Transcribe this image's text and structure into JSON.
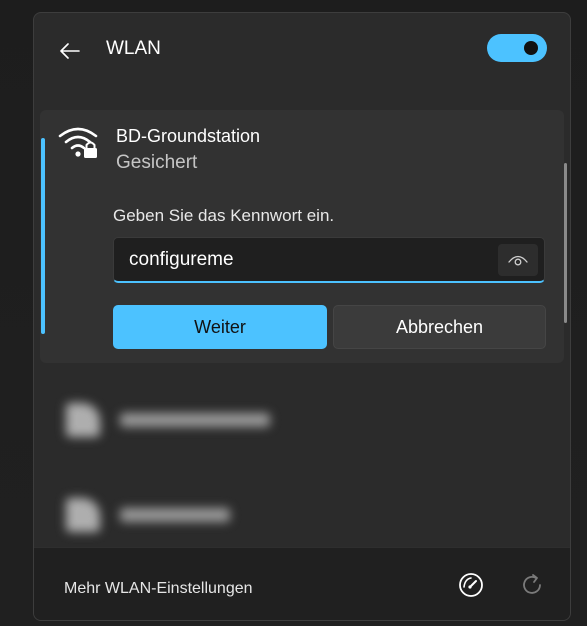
{
  "panel": {
    "title": "WLAN",
    "wifi_enabled": true
  },
  "network": {
    "name": "BD-Groundstation",
    "status": "Gesichert",
    "password_prompt": "Geben Sie das Kennwort ein.",
    "password_value": "configureme",
    "confirm_label": "Weiter",
    "cancel_label": "Abbrechen"
  },
  "footer": {
    "settings_link": "Mehr WLAN-Einstellungen"
  },
  "colors": {
    "accent": "#4cc2ff",
    "panel_bg": "#2b2b2b",
    "card_bg": "#323232"
  },
  "icons": {
    "back": "arrow-left-icon",
    "wifi_secure": "wifi-lock-icon",
    "reveal": "eye-icon",
    "speed": "speedometer-icon",
    "refresh": "refresh-icon"
  }
}
